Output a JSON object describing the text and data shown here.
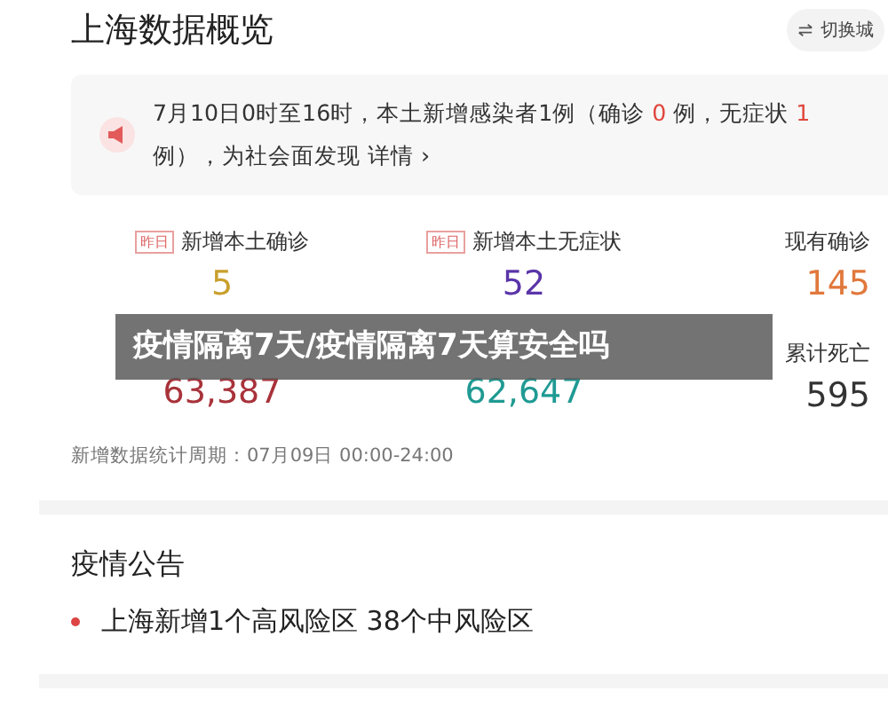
{
  "header": {
    "title": "上海数据概览",
    "switch_button": "切换城"
  },
  "notice": {
    "segments": [
      {
        "text": "7月10日0时至16时，本土新增感染者1例（确诊 ",
        "highlight": false
      },
      {
        "text": "0",
        "highlight": true
      },
      {
        "text": " 例，无症状 ",
        "highlight": false
      },
      {
        "text": "1",
        "highlight": true
      },
      {
        "text": " 例），为社会面发现 ",
        "highlight": false
      }
    ],
    "link": "详情 ›"
  },
  "stats": [
    {
      "badge": "昨日",
      "label": "新增本土确诊",
      "value": "5",
      "color": "#c9a02c"
    },
    {
      "badge": "昨日",
      "label": "新增本土无症状",
      "value": "52",
      "color": "#5a35a8"
    },
    {
      "label": "现有确诊",
      "value": "145",
      "color": "#e0783c"
    },
    {
      "value": "63,387",
      "color": "#a8323a"
    },
    {
      "value": "62,647",
      "color": "#1f9a93"
    },
    {
      "label": "累计死亡",
      "value": "595",
      "color": "#333333"
    }
  ],
  "period": "新增数据统计周期：07月09日 00:00-24:00",
  "overlay_banner": "疫情隔离7天/疫情隔离7天算安全吗",
  "announcements": {
    "title": "疫情公告",
    "items": [
      "上海新增1个高风险区 38个中风险区"
    ]
  }
}
